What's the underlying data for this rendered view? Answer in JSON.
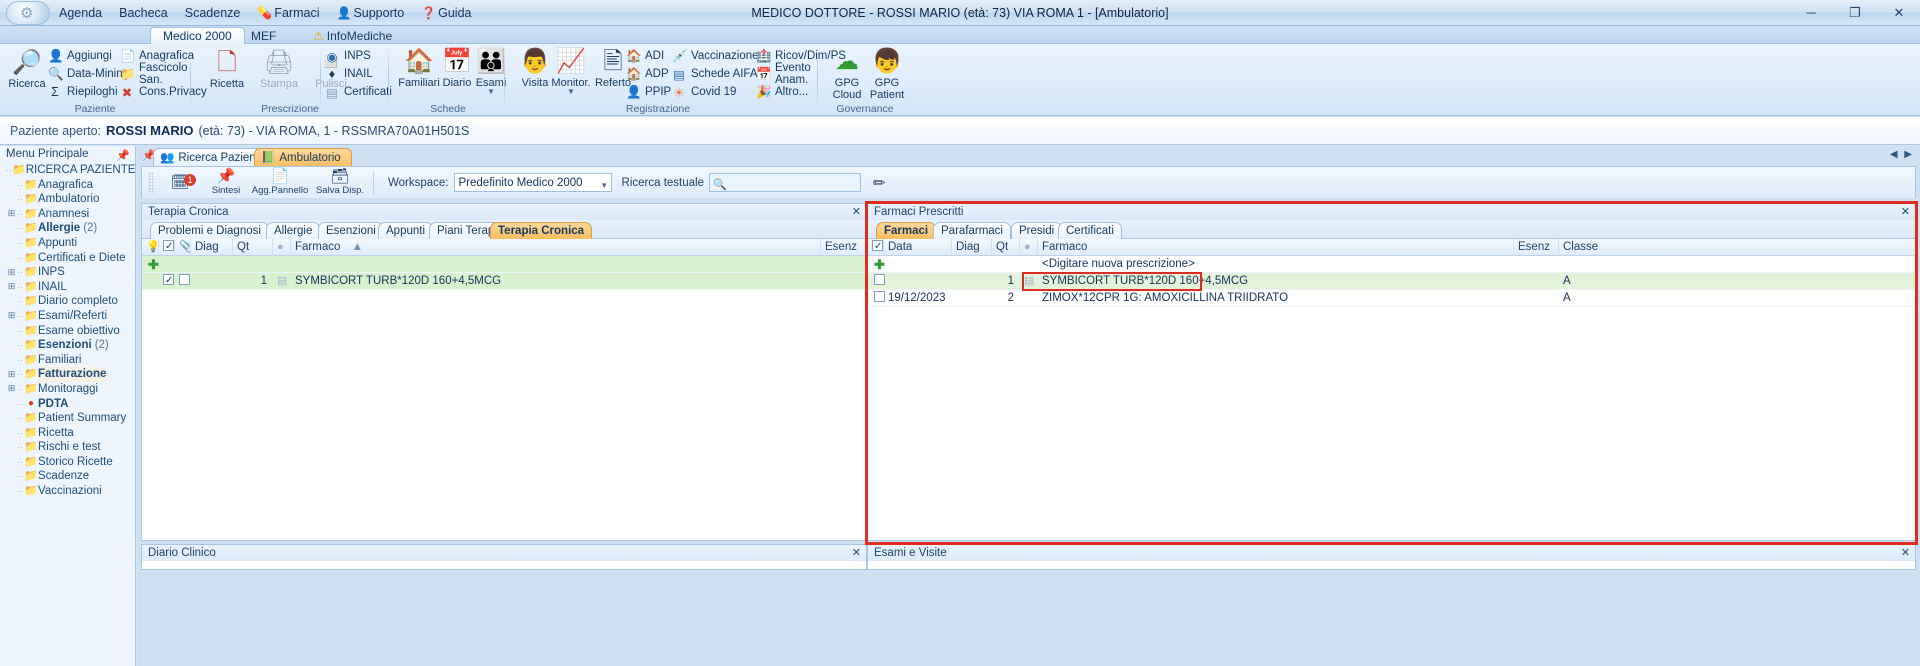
{
  "window": {
    "title": "MEDICO DOTTORE - ROSSI MARIO (età: 73) VIA ROMA 1 - [Ambulatorio]",
    "minimize": "─",
    "maximize": "❐",
    "close": "✕"
  },
  "menubar": [
    {
      "label": "Agenda",
      "icon": ""
    },
    {
      "label": "Bacheca",
      "icon": ""
    },
    {
      "label": "Scadenze",
      "icon": ""
    },
    {
      "label": "Farmaci",
      "icon": "pill-icon"
    },
    {
      "label": "Supporto",
      "icon": "person-icon"
    },
    {
      "label": "Guida",
      "icon": "help-icon"
    }
  ],
  "ribbon": {
    "tabs": [
      {
        "label": "Medico 2000",
        "active": true
      },
      {
        "label": "MEF",
        "active": false
      },
      {
        "label": "InfoMediche",
        "active": false,
        "icon": "warning-icon"
      }
    ],
    "groups": [
      {
        "name": "Paziente",
        "label": "Paziente",
        "big": [
          {
            "label": "Ricerca",
            "icon": "search-person-icon"
          }
        ],
        "small": [
          {
            "label": "Aggiungi",
            "icon": "add-person-icon"
          },
          {
            "label": "Data-Mining",
            "icon": "mining-icon"
          },
          {
            "label": "Riepiloghi",
            "icon": "sigma-icon"
          },
          {
            "label": "Anagrafica",
            "icon": "id-card-icon"
          },
          {
            "label": "Fascicolo San.",
            "icon": "folder-icon"
          },
          {
            "label": "Cons.Privacy",
            "icon": "privacy-icon"
          }
        ]
      },
      {
        "name": "Prescrizione",
        "label": "Prescrizione",
        "big": [
          {
            "label": "Ricetta",
            "icon": "prescription-icon"
          },
          {
            "label": "Stampa",
            "icon": "printer-icon",
            "disabled": true
          },
          {
            "label": "Pulisci",
            "icon": "eraser-icon",
            "disabled": true
          }
        ],
        "small": [
          {
            "label": "INPS",
            "icon": "inps-icon"
          },
          {
            "label": "INAIL",
            "icon": "inail-icon"
          },
          {
            "label": "Certificati",
            "icon": "certificate-icon"
          }
        ]
      },
      {
        "name": "Schede",
        "label": "Schede",
        "big": [
          {
            "label": "Familiari",
            "icon": "house-icon"
          },
          {
            "label": "Diario",
            "icon": "calendar-clock-icon"
          },
          {
            "label": "Esami",
            "icon": "people-icon",
            "caret": true
          }
        ],
        "small": []
      },
      {
        "name": "Registrazione",
        "label": "Registrazione",
        "big": [
          {
            "label": "Visita",
            "icon": "doctor-icon"
          },
          {
            "label": "Monitor.",
            "icon": "monitor-icon",
            "caret": true
          },
          {
            "label": "Referto",
            "icon": "report-add-icon"
          }
        ],
        "small": [
          {
            "label": "ADI",
            "icon": "adi-icon"
          },
          {
            "label": "ADP",
            "icon": "adp-icon"
          },
          {
            "label": "PPIP",
            "icon": "ppip-icon"
          },
          {
            "label": "Vaccinazione",
            "icon": "syringe-icon"
          },
          {
            "label": "Schede AIFA",
            "icon": "aifa-icon"
          },
          {
            "label": "Covid 19",
            "icon": "virus-icon"
          },
          {
            "label": "Ricov/Dim/PS",
            "icon": "hospital-icon"
          },
          {
            "label": "Evento Anam.",
            "icon": "event-icon"
          },
          {
            "label": "Altro...",
            "icon": "other-icon"
          }
        ]
      },
      {
        "name": "Governance",
        "label": "Governance",
        "big": [
          {
            "label": "GPG\nCloud",
            "label1": "GPG",
            "label2": "Cloud",
            "icon": "gpg-cloud-icon"
          },
          {
            "label": "GPG\nPatient",
            "label1": "GPG",
            "label2": "Patient",
            "icon": "gpg-patient-icon"
          }
        ],
        "small": []
      }
    ]
  },
  "patient_bar": {
    "label": "Paziente aperto:",
    "name": "ROSSI MARIO",
    "details": "(età: 73) - VIA ROMA, 1 - RSSMRA70A01H501S"
  },
  "sidebar": {
    "header": "Menu Principale",
    "items": [
      {
        "label": "RICERCA PAZIENTE",
        "icon": "folder-icon",
        "expandable": false,
        "bold": false
      },
      {
        "label": "Anagrafica",
        "icon": "folder-icon",
        "expandable": false,
        "bold": false
      },
      {
        "label": "Ambulatorio",
        "icon": "folder-icon",
        "expandable": false,
        "bold": false
      },
      {
        "label": "Anamnesi",
        "icon": "folder-icon",
        "expandable": true,
        "bold": false
      },
      {
        "label": "Allergie",
        "count": "(2)",
        "icon": "folder-icon",
        "expandable": false,
        "bold": true
      },
      {
        "label": "Appunti",
        "icon": "folder-icon",
        "expandable": false,
        "bold": false
      },
      {
        "label": "Certificati e Diete",
        "icon": "folder-icon",
        "expandable": false,
        "bold": false
      },
      {
        "label": "INPS",
        "icon": "folder-icon",
        "expandable": true,
        "bold": false
      },
      {
        "label": "INAIL",
        "icon": "folder-icon",
        "expandable": true,
        "bold": false
      },
      {
        "label": "Diario completo",
        "icon": "folder-icon",
        "expandable": false,
        "bold": false
      },
      {
        "label": "Esami/Referti",
        "icon": "folder-icon",
        "expandable": true,
        "bold": false
      },
      {
        "label": "Esame obiettivo",
        "icon": "folder-icon",
        "expandable": false,
        "bold": false
      },
      {
        "label": "Esenzioni",
        "count": "(2)",
        "icon": "folder-icon",
        "expandable": false,
        "bold": true
      },
      {
        "label": "Familiari",
        "icon": "folder-icon",
        "expandable": false,
        "bold": false
      },
      {
        "label": "Fatturazione",
        "icon": "folder-icon",
        "expandable": true,
        "bold": true,
        "selected": true
      },
      {
        "label": "Monitoraggi",
        "icon": "folder-icon",
        "expandable": true,
        "bold": false
      },
      {
        "label": "PDTA",
        "icon": "red-dot-icon",
        "expandable": false,
        "bold": true
      },
      {
        "label": "Patient Summary",
        "icon": "folder-icon",
        "expandable": false,
        "bold": false
      },
      {
        "label": "Ricetta",
        "icon": "folder-icon",
        "expandable": false,
        "bold": false
      },
      {
        "label": "Rischi e test",
        "icon": "folder-icon",
        "expandable": false,
        "bold": false
      },
      {
        "label": "Storico Ricette",
        "icon": "folder-icon",
        "expandable": false,
        "bold": false
      },
      {
        "label": "Scadenze",
        "icon": "folder-icon",
        "expandable": false,
        "bold": false
      },
      {
        "label": "Vaccinazioni",
        "icon": "folder-icon",
        "expandable": false,
        "bold": false
      }
    ]
  },
  "workspace": {
    "tabs": [
      {
        "label": "Ricerca Paziente",
        "icon": "people-icon",
        "active": false
      },
      {
        "label": "Ambulatorio",
        "icon": "book-icon",
        "active": true
      }
    ],
    "toolbar": {
      "buttons": [
        {
          "label": "Sintesi",
          "icon": "summary-icon",
          "badge": "1"
        },
        {
          "label": "Sintesi",
          "icon": "pin-icon"
        },
        {
          "label": "Agg.Pannello",
          "icon": "add-panel-icon"
        },
        {
          "label": "Salva Disp.",
          "icon": "save-layout-icon"
        }
      ],
      "workspace_label": "Workspace:",
      "workspace_value": "Predefinito Medico 2000",
      "search_label": "Ricerca testuale",
      "search_value": "",
      "search_placeholder": "",
      "eraser_icon": "eraser-icon"
    }
  },
  "left_panel": {
    "title": "Terapia Cronica",
    "close": "✕",
    "tabs": [
      {
        "label": "Problemi e Diagnosi",
        "active": false
      },
      {
        "label": "Allergie",
        "active": false
      },
      {
        "label": "Esenzioni",
        "active": false
      },
      {
        "label": "Appunti",
        "active": false
      },
      {
        "label": "Piani Terap.",
        "active": false
      },
      {
        "label": "Terapia Cronica",
        "active": true
      }
    ],
    "columns": [
      "Diag",
      "Qt",
      "Farmaco",
      "Esenz"
    ],
    "rows": [
      {
        "type": "add",
        "cells": [
          "",
          "",
          "",
          ""
        ]
      },
      {
        "type": "data",
        "checked": true,
        "diag": "",
        "qt": "1",
        "farmaco": "SYMBICORT TURB*120D 160+4,5MCG",
        "esenz": ""
      }
    ]
  },
  "right_panel": {
    "title": "Farmaci Prescritti",
    "close": "✕",
    "tabs": [
      {
        "label": "Farmaci",
        "active": true
      },
      {
        "label": "Parafarmaci",
        "active": false
      },
      {
        "label": "Presidi",
        "active": false
      },
      {
        "label": "Certificati",
        "active": false
      }
    ],
    "columns": [
      "Data",
      "Diag",
      "Qt",
      "Farmaco",
      "Esenz",
      "Classe"
    ],
    "new_prescription_placeholder": "<Digitare nuova prescrizione>",
    "rows": [
      {
        "type": "data",
        "checked": false,
        "data": "",
        "diag": "",
        "qt": "1",
        "farmaco": "SYMBICORT TURB*120D 160+4,5MCG",
        "esenz": "",
        "classe": "A",
        "highlighted": true
      },
      {
        "type": "data",
        "checked": false,
        "data": "19/12/2023",
        "diag": "",
        "qt": "2",
        "farmaco": "ZIMOX*12CPR 1G: AMOXICILLINA TRIIDRATO",
        "esenz": "",
        "classe": "A",
        "highlighted": false
      }
    ]
  },
  "bottom_panels": [
    {
      "title": "Diario Clinico",
      "close": "✕"
    },
    {
      "title": "Esami e Visite",
      "close": "✕"
    }
  ],
  "colors": {
    "accent": "#f8bd60",
    "annotation": "#e02b20",
    "green_row": "#d8f2d0",
    "chrome": "#cfe0f3"
  }
}
